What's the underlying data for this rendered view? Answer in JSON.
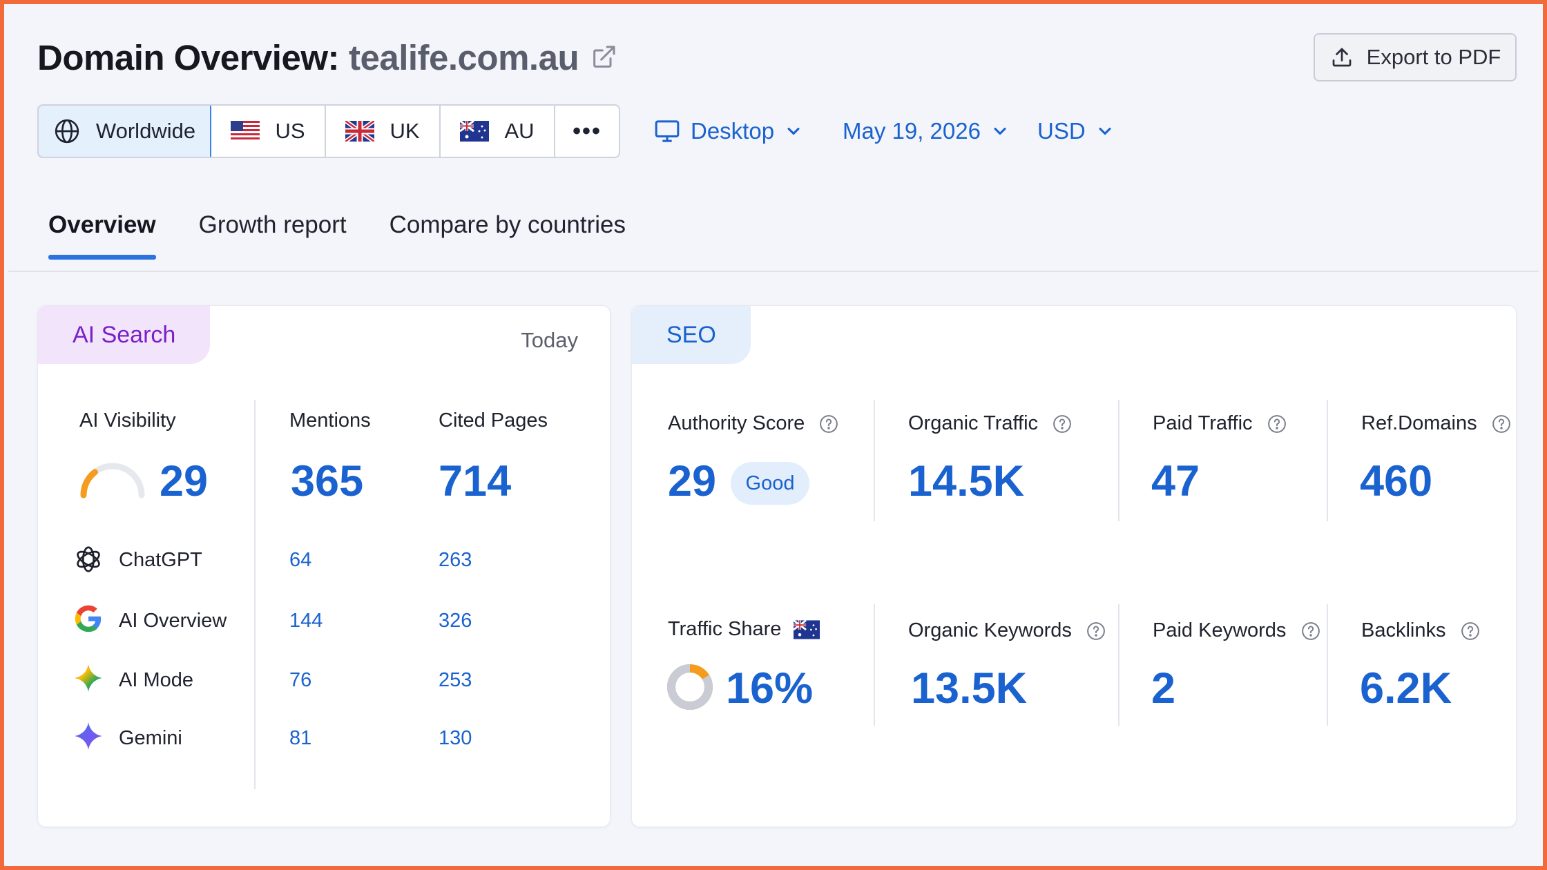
{
  "header": {
    "title_prefix": "Domain Overview:",
    "domain": "tealife.com.au",
    "export_label": "Export to PDF"
  },
  "regions": [
    {
      "label": "Worldwide",
      "icon": "globe-icon",
      "active": true
    },
    {
      "label": "US",
      "icon": "us-flag-icon"
    },
    {
      "label": "UK",
      "icon": "uk-flag-icon"
    },
    {
      "label": "AU",
      "icon": "au-flag-icon"
    }
  ],
  "more_label": "•••",
  "selectors": {
    "device": "Desktop",
    "date": "May 19, 2026",
    "currency": "USD"
  },
  "tabs": [
    {
      "label": "Overview",
      "active": true
    },
    {
      "label": "Growth report"
    },
    {
      "label": "Compare by countries"
    }
  ],
  "ai_search": {
    "tag": "AI Search",
    "period": "Today",
    "visibility_label": "AI Visibility",
    "visibility_value": "29",
    "visibility_score": 29,
    "mentions_label": "Mentions",
    "mentions_value": "365",
    "cited_label": "Cited Pages",
    "cited_value": "714",
    "rows": [
      {
        "name": "ChatGPT",
        "icon": "chatgpt-icon",
        "mentions": "64",
        "cited": "263"
      },
      {
        "name": "AI Overview",
        "icon": "google-icon",
        "mentions": "144",
        "cited": "326"
      },
      {
        "name": "AI Mode",
        "icon": "ai-mode-sparkle-icon",
        "mentions": "76",
        "cited": "253"
      },
      {
        "name": "Gemini",
        "icon": "gemini-icon",
        "mentions": "81",
        "cited": "130"
      }
    ]
  },
  "seo": {
    "tag": "SEO",
    "authority_label": "Authority Score",
    "authority_value": "29",
    "authority_badge": "Good",
    "organic_traffic_label": "Organic Traffic",
    "organic_traffic_value": "14.5K",
    "paid_traffic_label": "Paid Traffic",
    "paid_traffic_value": "47",
    "ref_domains_label": "Ref.Domains",
    "ref_domains_value": "460",
    "traffic_share_label": "Traffic Share",
    "traffic_share_value": "16%",
    "traffic_share_fraction": 0.16,
    "organic_keywords_label": "Organic Keywords",
    "organic_keywords_value": "13.5K",
    "paid_keywords_label": "Paid Keywords",
    "paid_keywords_value": "2",
    "backlinks_label": "Backlinks",
    "backlinks_value": "6.2K"
  },
  "colors": {
    "accent": "#1a62cf",
    "frame": "#f06a3b",
    "ai_tag_bg": "#f1e4fb",
    "seo_tag_bg": "#e4effb"
  }
}
